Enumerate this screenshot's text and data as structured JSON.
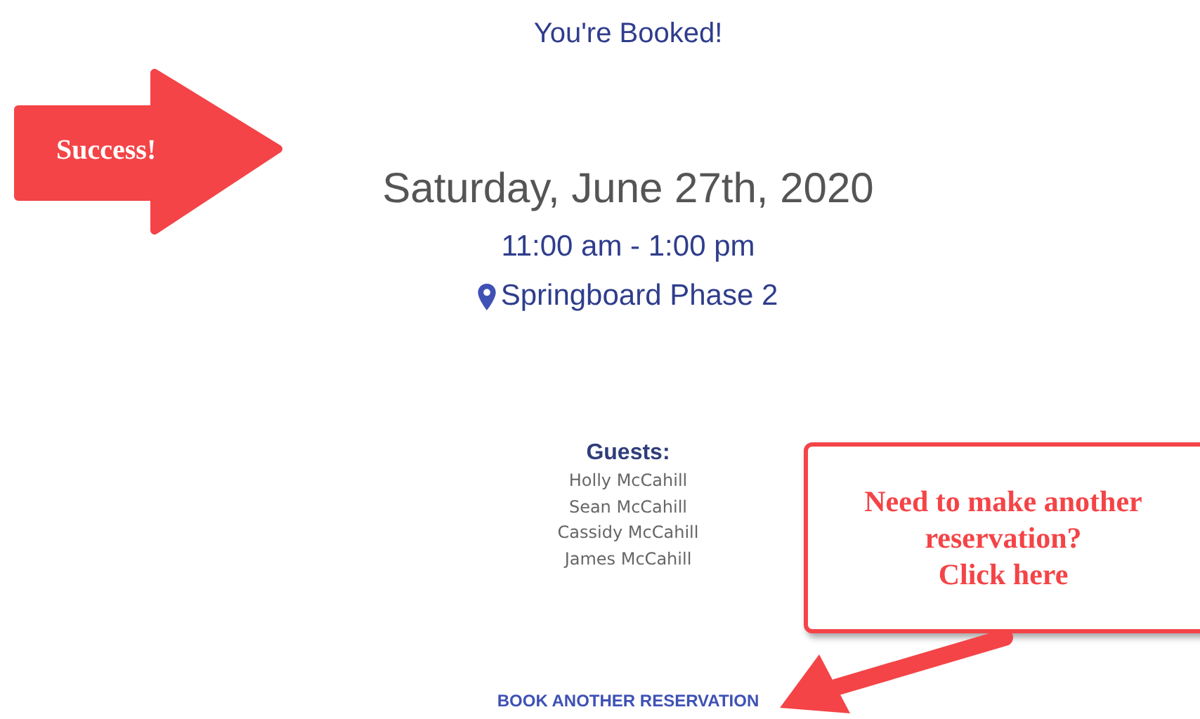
{
  "confirmation": {
    "title": "You're Booked!",
    "date": "Saturday, June 27th, 2020",
    "time": "11:00 am - 1:00 pm",
    "location": "Springboard Phase 2",
    "guests_heading": "Guests:",
    "guests": [
      "Holly McCahill",
      "Sean McCahill",
      "Cassidy McCahill",
      "James McCahill"
    ],
    "book_button": "BOOK ANOTHER RESERVATION"
  },
  "annotations": [
    {
      "kind": "arrow",
      "text": "Success!"
    },
    {
      "kind": "callout",
      "lines": [
        "Need to make another",
        "reservation?",
        "Click here"
      ]
    }
  ]
}
